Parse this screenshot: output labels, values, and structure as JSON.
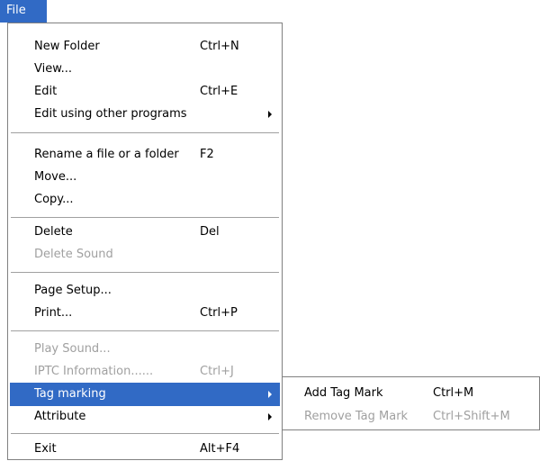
{
  "menubar": {
    "file_label": "File"
  },
  "menu": {
    "new_folder": {
      "label": "New Folder",
      "shortcut": "Ctrl+N"
    },
    "view": {
      "label": "View..."
    },
    "edit": {
      "label": "Edit",
      "shortcut": "Ctrl+E"
    },
    "edit_other": {
      "label": "Edit using other programs"
    },
    "rename": {
      "label": "Rename a file or a folder",
      "shortcut": "F2"
    },
    "move": {
      "label": "Move..."
    },
    "copy": {
      "label": "Copy..."
    },
    "delete": {
      "label": "Delete",
      "shortcut": "Del"
    },
    "delete_sound": {
      "label": "Delete Sound"
    },
    "page_setup": {
      "label": "Page Setup..."
    },
    "print": {
      "label": "Print...",
      "shortcut": "Ctrl+P"
    },
    "play_sound": {
      "label": "Play Sound..."
    },
    "iptc": {
      "label": "IPTC Information......",
      "shortcut": "Ctrl+J"
    },
    "tag_marking": {
      "label": "Tag marking"
    },
    "attribute": {
      "label": "Attribute"
    },
    "exit": {
      "label": "Exit",
      "shortcut": "Alt+F4"
    }
  },
  "submenu": {
    "add_tag": {
      "label": "Add Tag Mark",
      "shortcut": "Ctrl+M"
    },
    "remove_tag": {
      "label": "Remove Tag Mark",
      "shortcut": "Ctrl+Shift+M"
    }
  },
  "colors": {
    "highlight": "#316ac5",
    "disabled_text": "#a0a0a0",
    "menu_border": "#808080"
  },
  "icons": {
    "submenu_arrow": "submenu-arrow-icon"
  }
}
